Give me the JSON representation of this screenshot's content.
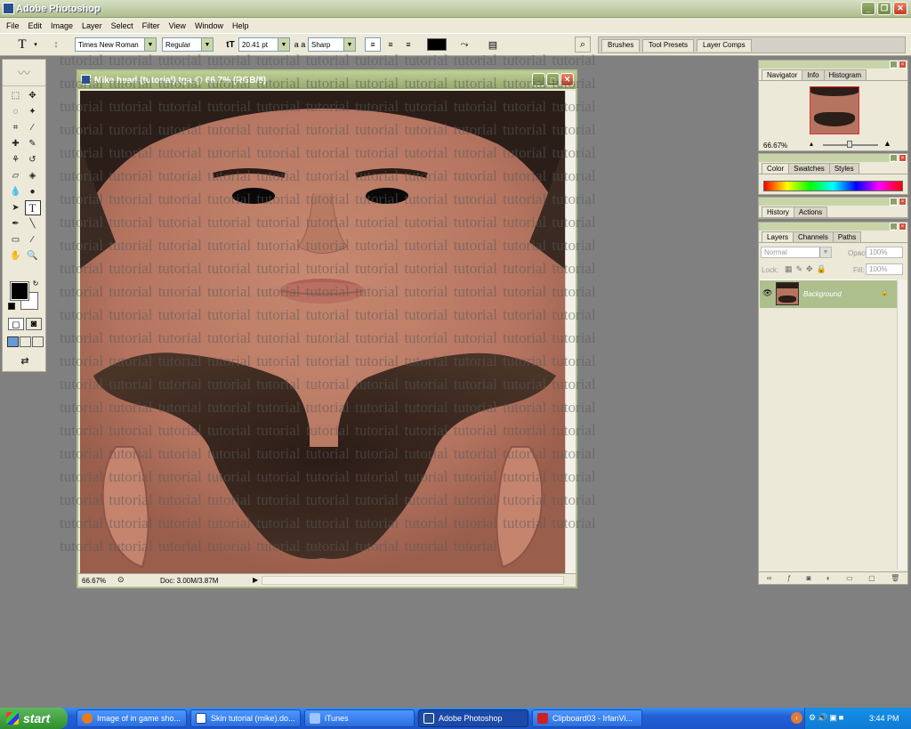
{
  "app": {
    "title": "Adobe Photoshop"
  },
  "menu": [
    "File",
    "Edit",
    "Image",
    "Layer",
    "Select",
    "Filter",
    "View",
    "Window",
    "Help"
  ],
  "options": {
    "tool_glyph": "T",
    "font_family": "Times New Roman",
    "font_style": "Regular",
    "font_size": "20.41 pt",
    "aa_glyph": "a a",
    "antialias": "Sharp",
    "text_color": "#000000"
  },
  "palette_well": [
    "Brushes",
    "Tool Presets",
    "Layer Comps"
  ],
  "document": {
    "title": "Mike head (tutorial).tga @ 66.7% (RGB/8)",
    "zoom": "66.67%",
    "doc_size": "Doc: 3.00M/3.87M"
  },
  "watermark_word": "tutorial",
  "navigator": {
    "tabs": [
      "Navigator",
      "Info",
      "Histogram"
    ],
    "zoom": "66.67%"
  },
  "color_panel": {
    "tabs": [
      "Color",
      "Swatches",
      "Styles"
    ]
  },
  "history_panel": {
    "tabs": [
      "History",
      "Actions"
    ]
  },
  "layers_panel": {
    "tabs": [
      "Layers",
      "Channels",
      "Paths"
    ],
    "blend_mode": "Normal",
    "opacity_label": "Opacity:",
    "opacity": "100%",
    "lock_label": "Lock:",
    "fill_label": "Fill:",
    "fill": "100%",
    "layers": [
      {
        "name": "Background",
        "visible": true,
        "locked": true
      }
    ]
  },
  "taskbar": {
    "start_label": "start",
    "buttons": [
      {
        "label": "Image of in game sho...",
        "icon": "firefox-icon"
      },
      {
        "label": "Skin tutorial (mike).do...",
        "icon": "word-icon"
      },
      {
        "label": "iTunes",
        "icon": "itunes-icon"
      },
      {
        "label": "Adobe Photoshop",
        "icon": "photoshop-icon",
        "active": true
      },
      {
        "label": "Clipboard03 - IrfanVi...",
        "icon": "irfanview-icon"
      }
    ],
    "clock": "3:44 PM"
  },
  "colors": {
    "xp_blue": "#2260d8",
    "layer_selected": "#aebf8e"
  }
}
